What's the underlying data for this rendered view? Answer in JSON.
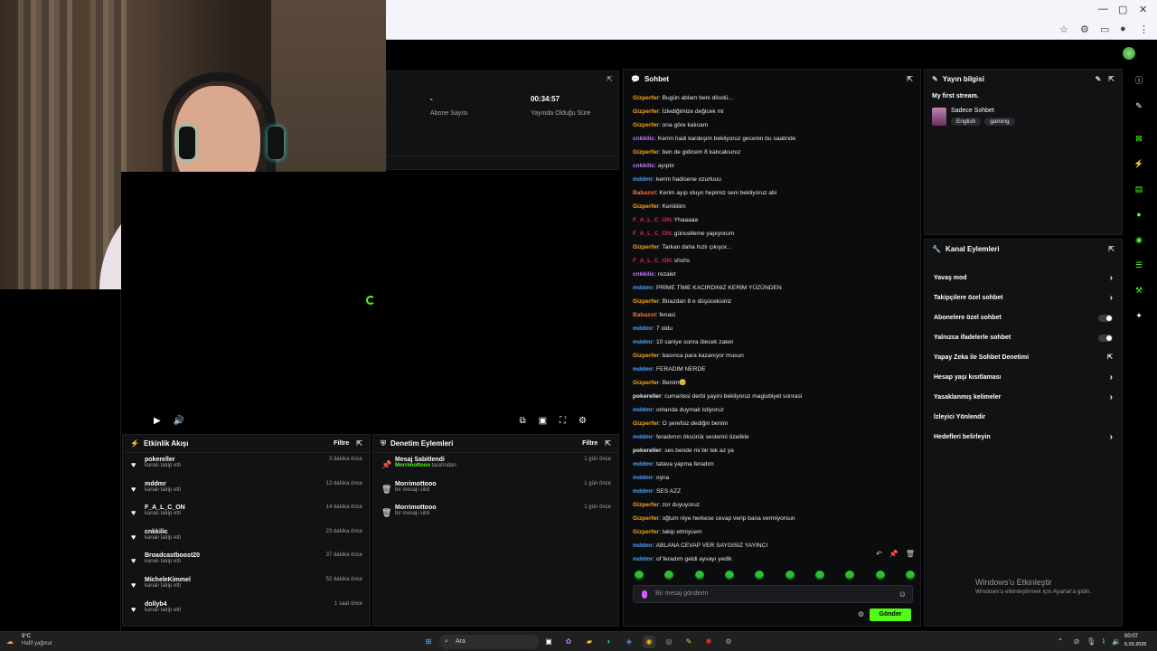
{
  "stats": {
    "subs_value": "-",
    "subs_label": "Abone Sayısı",
    "time_value": "00:34:57",
    "time_label": "Yayında Olduğu Süre"
  },
  "activity": {
    "title": "Etkinlik Akışı",
    "filter": "Filtre",
    "items": [
      {
        "name": "pokereller",
        "sub": "kanalı takip etti",
        "time": "3 dakika önce"
      },
      {
        "name": "mddmr",
        "sub": "kanalı takip etti",
        "time": "12 dakika önce"
      },
      {
        "name": "F_A_L_C_ON",
        "sub": "kanalı takip etti",
        "time": "14 dakika önce"
      },
      {
        "name": "cnkkilic",
        "sub": "kanalı takip etti",
        "time": "23 dakika önce"
      },
      {
        "name": "Broadcastboost20",
        "sub": "kanalı takip etti",
        "time": "37 dakika önce"
      },
      {
        "name": "MicheleKimmel",
        "sub": "kanalı takip etti",
        "time": "52 dakika önce"
      },
      {
        "name": "dollyb4",
        "sub": "kanalı takip etti",
        "time": "1 saat önce"
      }
    ]
  },
  "moderation": {
    "title": "Denetim Eylemleri",
    "filter": "Filtre",
    "items": [
      {
        "name": "Mesaj Sabitlendi",
        "user": "Morrimottooo",
        "sub": " tarafından",
        "time": "1 gün önce"
      },
      {
        "name": "Morrimottooo",
        "user": "",
        "sub": "bir mesajı sildi",
        "time": "1 gün önce"
      },
      {
        "name": "Morrimottooo",
        "user": "",
        "sub": "bir mesajı sildi",
        "time": "1 gün önce"
      }
    ]
  },
  "chat": {
    "title": "Sohbet",
    "placeholder": "Bir mesaj gönderin",
    "send": "Gönder",
    "messages": [
      {
        "user": "Gizperfer",
        "color": "#f5a623",
        "text": ": Bugün ablam beni dövdü..."
      },
      {
        "user": "Gizperfer",
        "color": "#f5a623",
        "text": ": İzlediğimize değicek mi"
      },
      {
        "user": "Gizperfer",
        "color": "#f5a623",
        "text": ": ona göre kalıcam"
      },
      {
        "user": "cnkkilic",
        "color": "#c77dff",
        "text": ": Kerim hadi kardeşim bekliyoruz gecenin bu saatinde"
      },
      {
        "user": "Gizperfer",
        "color": "#f5a623",
        "text": ": ben de gidicem 8 kalıcaksınız"
      },
      {
        "user": "cnkkilic",
        "color": "#c77dff",
        "text": ": ayıptır"
      },
      {
        "user": "mddmr",
        "color": "#4aa3ff",
        "text": ": kerim hadisene ozurluuu"
      },
      {
        "user": "Babazot",
        "color": "#ff6a3d",
        "text": ": Kerim ayıp oluyo hepimiz seni bekliyoruz abi"
      },
      {
        "user": "Gizperfer",
        "color": "#f5a623",
        "text": ": Keriiiiiiim"
      },
      {
        "user": "F_A_L_C_ON",
        "color": "#e0245e",
        "text": ": Yhaaaaa"
      },
      {
        "user": "F_A_L_C_ON",
        "color": "#e0245e",
        "text": ": güncelleme yapıyorum"
      },
      {
        "user": "Gizperfer",
        "color": "#f5a623",
        "text": ": Tarkan daha hızlı çıkıyor..."
      },
      {
        "user": "F_A_L_C_ON",
        "color": "#e0245e",
        "text": ": shshs"
      },
      {
        "user": "cnkkilic",
        "color": "#c77dff",
        "text": ": rezalet"
      },
      {
        "user": "mddmr",
        "color": "#4aa3ff",
        "text": ": PRİME TİME KACIRDINIZ KERİM YÜZÜNDEN"
      },
      {
        "user": "Gizperfer",
        "color": "#f5a623",
        "text": ": Birazdan 8 e düşüceksiniz"
      },
      {
        "user": "Babazot",
        "color": "#ff6a3d",
        "text": ": fenasi"
      },
      {
        "user": "mddmr",
        "color": "#4aa3ff",
        "text": ": 7 oldu"
      },
      {
        "user": "mddmr",
        "color": "#4aa3ff",
        "text": ": 10 saniye sonra ölecek zaten"
      },
      {
        "user": "Gizperfer",
        "color": "#f5a623",
        "text": ": basınca para kazanıyor musun"
      },
      {
        "user": "mddmr",
        "color": "#4aa3ff",
        "text": ": FERADIM NERDE"
      },
      {
        "user": "Gizperfer",
        "color": "#f5a623",
        "text": ": Benim🥺"
      },
      {
        "user": "pokereller",
        "color": "#e8e8e8",
        "text": ": cumartesi derbi yayini bekliyoruz maglubiyet sonrasi"
      },
      {
        "user": "mddmr",
        "color": "#4aa3ff",
        "text": ": onlarıda duymak istiyoruz"
      },
      {
        "user": "Gizperfer",
        "color": "#f5a623",
        "text": ": O şerefsiz dediğin benim"
      },
      {
        "user": "mddmr",
        "color": "#4aa3ff",
        "text": ": feradımın öksürük seslerini özelikle"
      },
      {
        "user": "pokereller",
        "color": "#e8e8e8",
        "text": ": ses bende mi bir tek az ya"
      },
      {
        "user": "mddmr",
        "color": "#4aa3ff",
        "text": ": tatava yapma feradım"
      },
      {
        "user": "mddmr",
        "color": "#4aa3ff",
        "text": ": oyna"
      },
      {
        "user": "mddmr",
        "color": "#4aa3ff",
        "text": ": SES AZZ"
      },
      {
        "user": "Gizperfer",
        "color": "#f5a623",
        "text": ": zor duyuyoruz"
      },
      {
        "user": "Gizperfer",
        "color": "#f5a623",
        "text": ": oğlum niye herkese cevap verip bana vermiyorsun"
      },
      {
        "user": "Gizperfer",
        "color": "#f5a623",
        "text": ": takip etmiycem"
      },
      {
        "user": "mddmr",
        "color": "#4aa3ff",
        "text": ": ABLANA CEVAP VER SAYGISIZ YAYINCI"
      },
      {
        "user": "mddmr",
        "color": "#4aa3ff",
        "text": ": of feradım geldi ayvayı yedik"
      }
    ]
  },
  "stream_info": {
    "title": "Yayın bilgisi",
    "stream_title": "My first stream.",
    "category": "Sadece Sohbet",
    "tags": [
      "English",
      "gaming"
    ]
  },
  "channel_actions": {
    "title": "Kanal Eylemleri",
    "rows": [
      {
        "label": "Yavaş mod",
        "kind": "chevron"
      },
      {
        "label": "Takipçilere özel sohbet",
        "kind": "chevron"
      },
      {
        "label": "Abonelere özel sohbet",
        "kind": "toggle"
      },
      {
        "label": "Yalnızca ifadelerle sohbet",
        "kind": "toggle"
      },
      {
        "label": "Yapay Zeka ile Sohbet Denetimi",
        "kind": "external"
      },
      {
        "label": "Hesap yaşı kısıtlaması",
        "kind": "chevron"
      },
      {
        "label": "Yasaklanmış kelimeler",
        "kind": "chevron"
      },
      {
        "label": "İzleyici Yönlendir",
        "kind": "none"
      },
      {
        "label": "Hedefleri belirleyin",
        "kind": "chevron"
      }
    ]
  },
  "watermark": {
    "title": "Windows'u Etkinleştir",
    "sub": "Windows'u etkinleştirmek için Ayarlar'a gidin."
  },
  "taskbar": {
    "weather_temp": "9°C",
    "weather_desc": "Hafif yağmur",
    "search": "Ara",
    "time": "00:07",
    "date": "6.03.2026"
  },
  "colors": {
    "accent": "#53fc18"
  }
}
